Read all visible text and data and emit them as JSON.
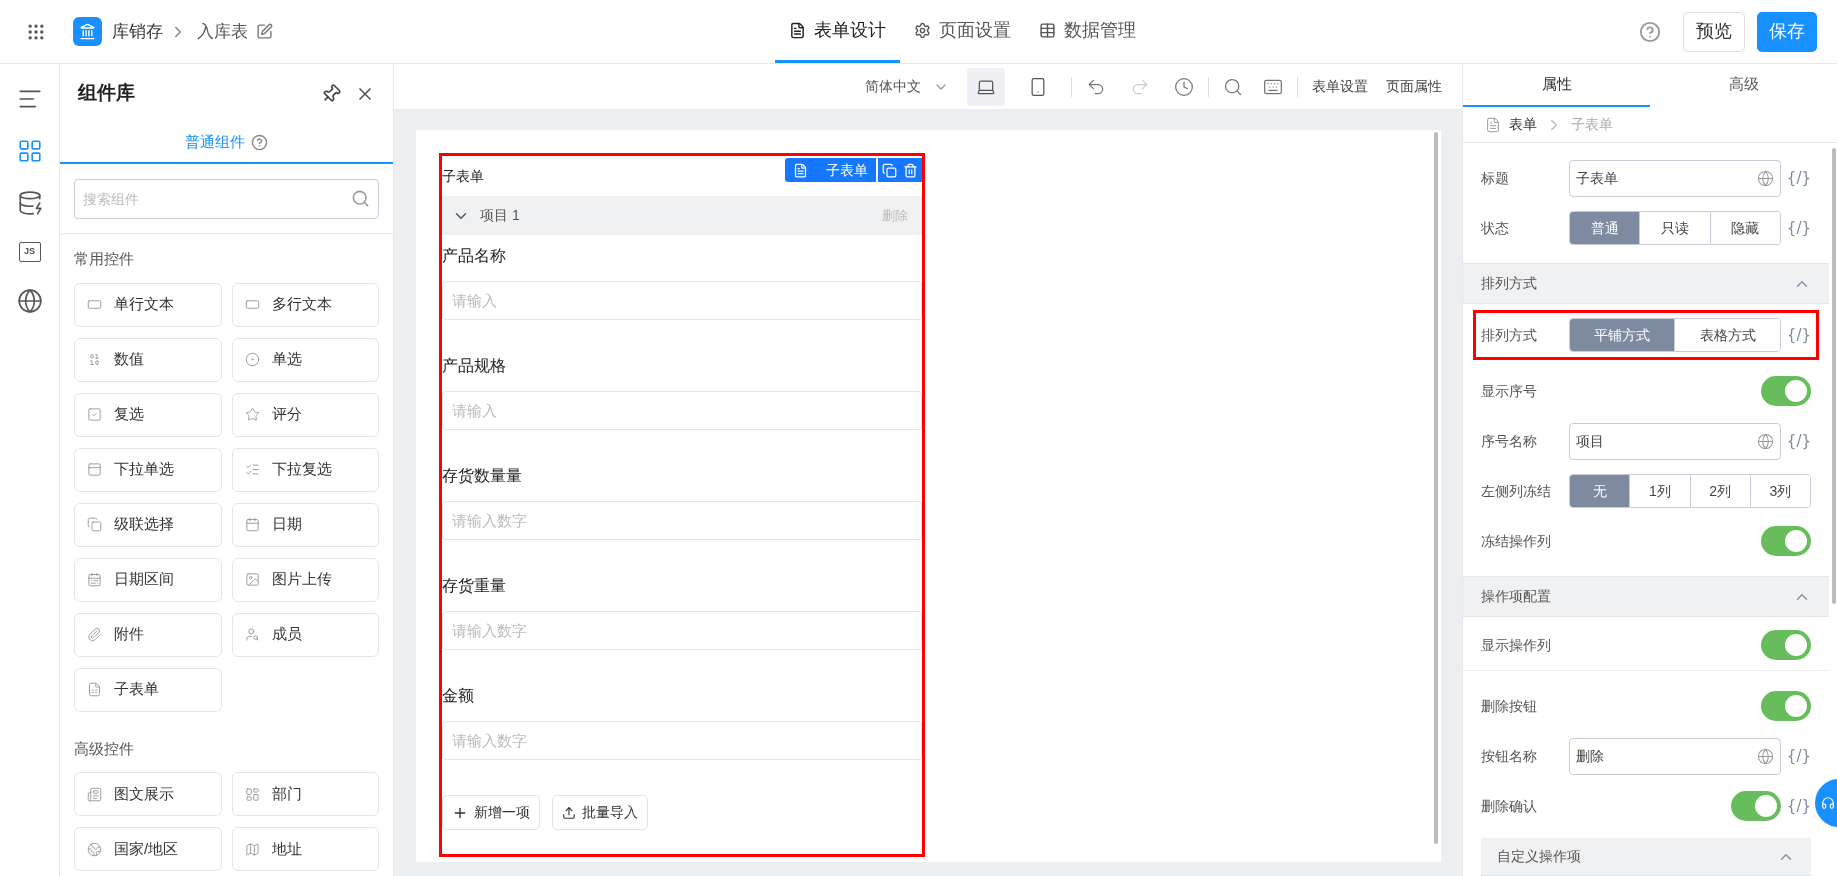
{
  "top_bar": {
    "app_name": "库销存",
    "page_name": "入库表",
    "tabs": [
      {
        "label": "表单设计",
        "kind": "form",
        "selected": true
      },
      {
        "label": "页面设置",
        "kind": "settings",
        "selected": false
      },
      {
        "label": "数据管理",
        "kind": "table",
        "selected": false
      }
    ],
    "buttons": [
      {
        "label": "预览",
        "kind": "secondary"
      },
      {
        "label": "保存",
        "kind": "primary"
      }
    ]
  },
  "rail": [
    {
      "kind": "outline",
      "selected": false
    },
    {
      "kind": "components",
      "selected": true
    },
    {
      "kind": "data",
      "selected": false
    },
    {
      "kind": "script",
      "label": "JS",
      "selected": false
    },
    {
      "kind": "language",
      "selected": false
    }
  ],
  "library": {
    "title": "组件库",
    "tabs": [
      {
        "label": "普通组件",
        "selected": true
      }
    ],
    "search": {
      "placeholder": "搜索组件"
    },
    "sections": [
      {
        "title": "常用控件",
        "items": [
          {
            "label": "单行文本",
            "kind": "text"
          },
          {
            "label": "多行文本",
            "kind": "textarea"
          },
          {
            "label": "数值",
            "kind": "number"
          },
          {
            "label": "单选",
            "kind": "radio"
          },
          {
            "label": "复选",
            "kind": "checkbox"
          },
          {
            "label": "评分",
            "kind": "rating"
          },
          {
            "label": "下拉单选",
            "kind": "select"
          },
          {
            "label": "下拉复选",
            "kind": "multiselect"
          },
          {
            "label": "级联选择",
            "kind": "cascader"
          },
          {
            "label": "日期",
            "kind": "date"
          },
          {
            "label": "日期区间",
            "kind": "daterange"
          },
          {
            "label": "图片上传",
            "kind": "image"
          },
          {
            "label": "附件",
            "kind": "attachment"
          },
          {
            "label": "成员",
            "kind": "member"
          },
          {
            "label": "子表单",
            "kind": "subform"
          }
        ]
      },
      {
        "title": "高级控件",
        "items": [
          {
            "label": "图文展示",
            "kind": "richtext"
          },
          {
            "label": "部门",
            "kind": "department"
          },
          {
            "label": "国家/地区",
            "kind": "country"
          },
          {
            "label": "地址",
            "kind": "address"
          }
        ]
      }
    ]
  },
  "toolbar": {
    "language": "简体中文",
    "devices": [
      {
        "kind": "desktop",
        "selected": true
      },
      {
        "kind": "mobile",
        "selected": false
      }
    ],
    "history": [
      {
        "kind": "undo",
        "disabled": false
      },
      {
        "kind": "redo",
        "disabled": true
      },
      {
        "kind": "history",
        "disabled": false
      }
    ],
    "tools": [
      {
        "kind": "search"
      },
      {
        "kind": "keyboard"
      }
    ],
    "links": [
      "表单设置",
      "页面属性"
    ]
  },
  "subform": {
    "title": "子表单",
    "badge": "子表单",
    "highlighted": true,
    "rows": [
      {
        "label": "项目 1",
        "delete": "删除",
        "expanded": true
      }
    ],
    "fields": [
      {
        "label": "产品名称",
        "placeholder": "请输入"
      },
      {
        "label": "产品规格",
        "placeholder": "请输入"
      },
      {
        "label": "存货数量量",
        "placeholder": "请输入数字"
      },
      {
        "label": "存货重量",
        "placeholder": "请输入数字"
      },
      {
        "label": "金额",
        "placeholder": "请输入数字"
      }
    ],
    "actions": [
      {
        "label": "新增一项",
        "kind": "add"
      },
      {
        "label": "批量导入",
        "kind": "import"
      }
    ]
  },
  "properties": {
    "tabs": [
      {
        "label": "属性",
        "selected": true
      },
      {
        "label": "高级",
        "selected": false
      }
    ],
    "breadcrumb": [
      {
        "label": "表单",
        "current": false
      },
      {
        "label": "子表单",
        "current": true
      }
    ],
    "items": [
      {
        "kind": "input",
        "label": "标题",
        "value": "子表单",
        "code": "{/}"
      },
      {
        "kind": "segmented",
        "label": "状态",
        "options": [
          {
            "label": "普通",
            "selected": true
          },
          {
            "label": "只读",
            "selected": false
          },
          {
            "label": "隐藏",
            "selected": false
          }
        ],
        "code": "{/}"
      },
      {
        "kind": "section",
        "label": "排列方式",
        "expanded": true
      },
      {
        "kind": "segmented",
        "label": "排列方式",
        "highlighted": true,
        "options": [
          {
            "label": "平铺方式",
            "selected": true
          },
          {
            "label": "表格方式",
            "selected": false
          }
        ],
        "code": "{/}"
      },
      {
        "kind": "toggle",
        "label": "显示序号",
        "on": true
      },
      {
        "kind": "input",
        "label": "序号名称",
        "value": "项目",
        "code": "{/}"
      },
      {
        "kind": "segmented",
        "label": "左侧列冻结",
        "options": [
          {
            "label": "无",
            "selected": true
          },
          {
            "label": "1列",
            "selected": false
          },
          {
            "label": "2列",
            "selected": false
          },
          {
            "label": "3列",
            "selected": false
          }
        ]
      },
      {
        "kind": "toggle",
        "label": "冻结操作列",
        "on": true
      },
      {
        "kind": "section",
        "label": "操作项配置",
        "expanded": true
      },
      {
        "kind": "toggle",
        "label": "显示操作列",
        "on": true,
        "divider": true
      },
      {
        "kind": "toggle",
        "label": "删除按钮",
        "on": true
      },
      {
        "kind": "input",
        "label": "按钮名称",
        "value": "删除",
        "code": "{/}"
      },
      {
        "kind": "toggle",
        "label": "删除确认",
        "on": true,
        "code": "{/}"
      },
      {
        "kind": "subsection",
        "label": "自定义操作项",
        "expanded": true
      }
    ]
  }
}
